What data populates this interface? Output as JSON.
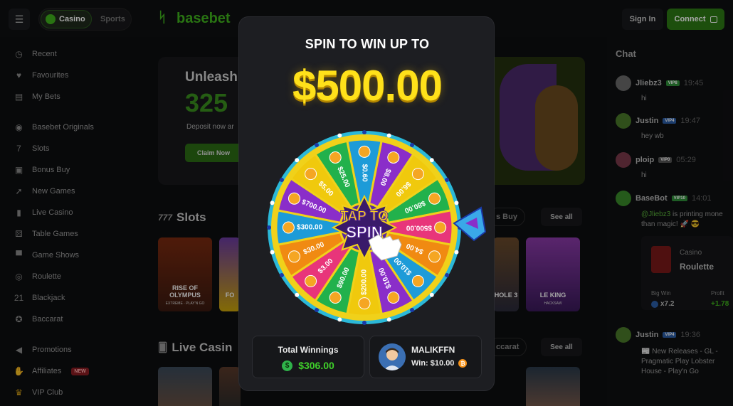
{
  "topbar": {
    "casino_label": "Casino",
    "sports_label": "Sports",
    "logo_text": "basebet",
    "signin_label": "Sign In",
    "connect_label": "Connect"
  },
  "sidebar": {
    "items": [
      {
        "label": "Recent",
        "icon": "clock-icon"
      },
      {
        "label": "Favourites",
        "icon": "heart-icon"
      },
      {
        "label": "My Bets",
        "icon": "receipt-icon"
      },
      {
        "label": "Basebet Originals",
        "icon": "gamepad-icon"
      },
      {
        "label": "Slots",
        "icon": "slots-777-icon"
      },
      {
        "label": "Bonus Buy",
        "icon": "gift-icon"
      },
      {
        "label": "New Games",
        "icon": "rocket-icon"
      },
      {
        "label": "Live Casino",
        "icon": "cards-icon"
      },
      {
        "label": "Table Games",
        "icon": "dice-icon"
      },
      {
        "label": "Game Shows",
        "icon": "tophat-icon"
      },
      {
        "label": "Roulette",
        "icon": "roulette-icon"
      },
      {
        "label": "Blackjack",
        "icon": "blackjack-21-icon"
      },
      {
        "label": "Baccarat",
        "icon": "chip-icon"
      },
      {
        "label": "Promotions",
        "icon": "megaphone-icon"
      },
      {
        "label": "Affiliates",
        "icon": "handshake-icon",
        "badge": "NEW"
      },
      {
        "label": "VIP Club",
        "icon": "crown-icon"
      }
    ]
  },
  "hero": {
    "title": "Unleash",
    "amount": "325",
    "subtitle": "Deposit now ar",
    "cta": "Claim Now"
  },
  "sections": {
    "slots_title": "Slots",
    "slots_see_all": "See all",
    "bonus_buy_label": "s Buy",
    "live_title": "Live Casin",
    "live_see_all": "See all",
    "baccarat_label": "ccarat"
  },
  "games": [
    {
      "title": "RISE OF OLYMPUS",
      "sub": "EXTREME · PLAY'N GO"
    },
    {
      "title": "FO",
      "sub": ""
    },
    {
      "title": "HOLE 3",
      "sub": ""
    },
    {
      "title": "LE KING",
      "sub": "HACKSAW"
    }
  ],
  "modal": {
    "title": "SPIN TO WIN UP TO",
    "amount": "$500.00",
    "tap_line1": "TAP TO",
    "tap_line2": "SPIN",
    "segments": [
      "$0.60",
      "$8.00",
      "$6.00",
      "$80.00",
      "$500.00",
      "$4.00",
      "$10.00",
      "$10.00",
      "$200.00",
      "$90.00",
      "$3.00",
      "$30.00",
      "$300.00",
      "$700.00",
      "$5.00",
      "$25.00"
    ],
    "total_winnings_label": "Total Winnings",
    "total_winnings_value": "$306.00",
    "winner_name": "MALIKFFN",
    "winner_win": "Win: $10.00"
  },
  "chat": {
    "title": "Chat",
    "messages": [
      {
        "user": "Jliebz3",
        "vip": "VIP8",
        "time": "19:45",
        "text": "hi"
      },
      {
        "user": "Justin",
        "vip": "VIP4",
        "time": "19:47",
        "text": "hey wb"
      },
      {
        "user": "ploip",
        "vip": "VIP0",
        "time": "05:29",
        "text": "hi"
      },
      {
        "user": "BaseBot",
        "vip": "VIP10",
        "time": "14:01",
        "text_green": "@Jliebz3",
        "text": " is printing mone than magic! 🚀 😎"
      },
      {
        "user": "Justin",
        "vip": "VIP4",
        "time": "19:36",
        "text": "📰 New Releases - GL - Pragmatic Play Lobster House  - Play'n Go"
      }
    ],
    "bet": {
      "game_category": "Casino",
      "game_name": "Roulette",
      "big_win_label": "Big Win",
      "big_win_value": "x7.2",
      "profit_label": "Profit",
      "profit_value": "+1.78"
    }
  },
  "colors": {
    "accent": "#3fb21c",
    "gold": "#ffe11a",
    "wheel_segments": [
      "#1d9bd8",
      "#8a2ec9",
      "#f0c90d",
      "#22b14c",
      "#e8357a",
      "#f08a12"
    ]
  }
}
